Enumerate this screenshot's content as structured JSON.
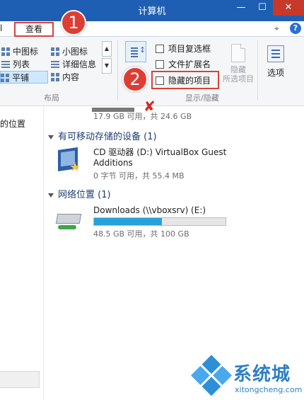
{
  "window": {
    "title": "计算机"
  },
  "tabs": {
    "partial_left": "l",
    "view": "查看"
  },
  "ribbon": {
    "layout": {
      "items": [
        {
          "label": "中图标",
          "icon": "medium-icons-icon"
        },
        {
          "label": "小图标",
          "icon": "small-icons-icon"
        },
        {
          "label": "列表",
          "icon": "list-icon"
        },
        {
          "label": "详细信息",
          "icon": "details-icon"
        },
        {
          "label": "平铺",
          "icon": "tiles-icon",
          "selected": true
        },
        {
          "label": "内容",
          "icon": "content-icon"
        }
      ],
      "group_label": "布局"
    },
    "show_hide": {
      "item_checkboxes": "项目复选框",
      "file_extensions": "文件扩展名",
      "hidden_items": "隐藏的项目",
      "hide_selected_1": "隐藏",
      "hide_selected_2": "所选项目",
      "group_label": "显示/隐藏"
    },
    "options_label": "选项"
  },
  "callouts": {
    "one": "1",
    "two": "2",
    "x": "✘"
  },
  "nav": {
    "location": "的位置"
  },
  "content": {
    "partial_drive_info": "17.9 GB 可用，共 24.6 GB",
    "sections": {
      "removable": "有可移动存储的设备 (1)",
      "network": "网络位置 (1)"
    },
    "cd_drive": {
      "name_line1": "CD 驱动器 (D:) VirtualBox Guest",
      "name_line2": "Additions",
      "info": "0 字节 可用，共 55.4 MB"
    },
    "network_drive": {
      "name": "Downloads (\\\\vboxsrv) (E:)",
      "info": "48.5 GB 可用，共 100 GB",
      "used_fraction": 0.515
    }
  },
  "watermark": {
    "brand": "系统城",
    "url": "xitongcheng.com"
  },
  "colors": {
    "titlebar": "#1f5fb3",
    "highlight_red": "#d9423c",
    "bar_fill": "#26a0da"
  }
}
